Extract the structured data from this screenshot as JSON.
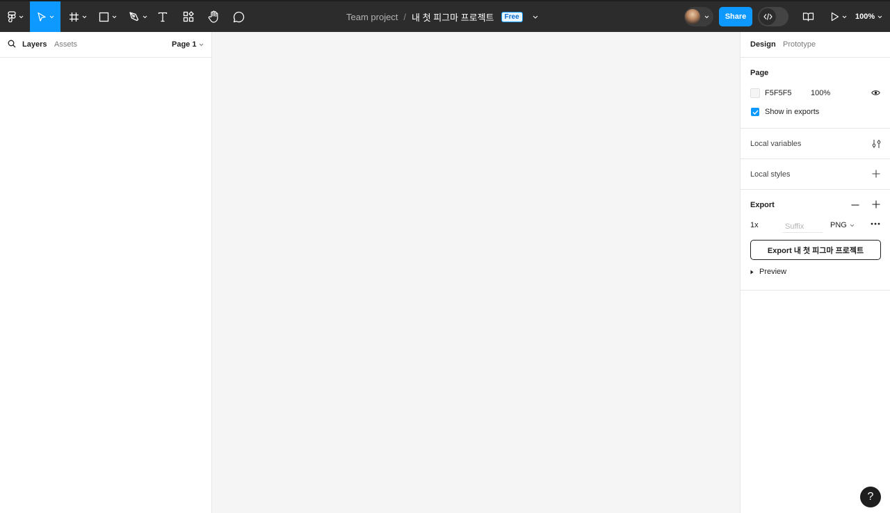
{
  "toolbar": {
    "icons": [
      "figma-menu-icon",
      "move-tool-icon",
      "frame-tool-icon",
      "rectangle-tool-icon",
      "pen-tool-icon",
      "text-tool-icon",
      "components-icon",
      "hand-tool-icon",
      "comment-icon",
      "library-icon",
      "present-icon"
    ],
    "active_tool": "move-tool",
    "accent_color": "#0d99ff",
    "background_color": "#2c2c2c"
  },
  "file": {
    "project": "Team project",
    "separator": "/",
    "name": "내 첫 피그마 프로젝트",
    "plan_badge": "Free"
  },
  "header": {
    "share_label": "Share",
    "zoom": "100%"
  },
  "left_panel": {
    "tabs": [
      "Layers",
      "Assets"
    ],
    "page_selector": "Page 1"
  },
  "canvas": {
    "background": "#f5f5f5"
  },
  "right_panel": {
    "tabs": [
      "Design",
      "Prototype"
    ],
    "page": {
      "title": "Page",
      "color_hex": "F5F5F5",
      "opacity": "100%",
      "show_in_exports_label": "Show in exports",
      "show_in_exports": true
    },
    "local_variables_label": "Local variables",
    "local_styles_label": "Local styles",
    "export": {
      "title": "Export",
      "scale": "1x",
      "suffix_placeholder": "Suffix",
      "format": "PNG",
      "button_label": "Export 내 첫 피그마 프로젝트",
      "preview_label": "Preview"
    }
  },
  "help": {
    "label": "?"
  }
}
